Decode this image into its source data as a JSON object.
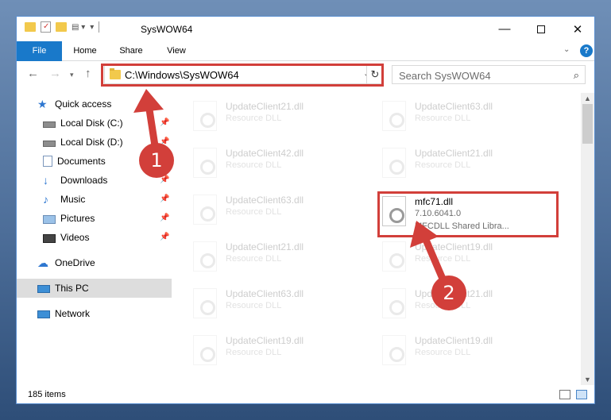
{
  "window": {
    "title": "SysWOW64"
  },
  "ribbon": {
    "tabs": [
      "File",
      "Home",
      "Share",
      "View"
    ]
  },
  "address": {
    "path": "C:\\Windows\\SysWOW64",
    "search_placeholder": "Search SysWOW64"
  },
  "sidebar": {
    "items": [
      {
        "label": "Quick access",
        "icon": "star-icon"
      },
      {
        "label": "Local Disk (C:)",
        "icon": "drive-icon",
        "pinned": true
      },
      {
        "label": "Local Disk (D:)",
        "icon": "drive-icon",
        "pinned": true
      },
      {
        "label": "Documents",
        "icon": "documents-icon",
        "pinned": true
      },
      {
        "label": "Downloads",
        "icon": "download-icon",
        "pinned": true
      },
      {
        "label": "Music",
        "icon": "music-icon",
        "pinned": true
      },
      {
        "label": "Pictures",
        "icon": "pictures-icon",
        "pinned": true
      },
      {
        "label": "Videos",
        "icon": "videos-icon",
        "pinned": true
      },
      {
        "label": "OneDrive",
        "icon": "cloud-icon"
      },
      {
        "label": "This PC",
        "icon": "computer-icon",
        "selected": true
      },
      {
        "label": "Network",
        "icon": "network-icon"
      }
    ]
  },
  "files": {
    "left": [
      {
        "name": "UpdateClient21.dll",
        "type": "Resource DLL"
      },
      {
        "name": "UpdateClient42.dll",
        "type": "Resource DLL"
      },
      {
        "name": "UpdateClient63.dll",
        "type": "Resource DLL"
      },
      {
        "name": "UpdateClient21.dll",
        "type": "Resource DLL"
      },
      {
        "name": "UpdateClient63.dll",
        "type": "Resource DLL"
      },
      {
        "name": "UpdateClient19.dll",
        "type": "Resource DLL"
      }
    ],
    "right": [
      {
        "name": "UpdateClient63.dll",
        "type": "Resource DLL"
      },
      {
        "name": "UpdateClient21.dll",
        "type": "Resource DLL"
      },
      {
        "name": "UpdateClient19.dll",
        "type": "Resource DLL"
      },
      {
        "name": "UpdateClient21.dll",
        "type": "Resource DLL"
      },
      {
        "name": "UpdateClient19.dll",
        "type": "Resource DLL"
      }
    ],
    "highlighted": {
      "name": "mfc71.dll",
      "version": "7.10.6041.0",
      "description": "MFCDLL Shared Libra..."
    }
  },
  "status": {
    "items_count": "185 items"
  },
  "annotations": {
    "badge_1": "1",
    "badge_2": "2",
    "color": "#d23f3a"
  }
}
